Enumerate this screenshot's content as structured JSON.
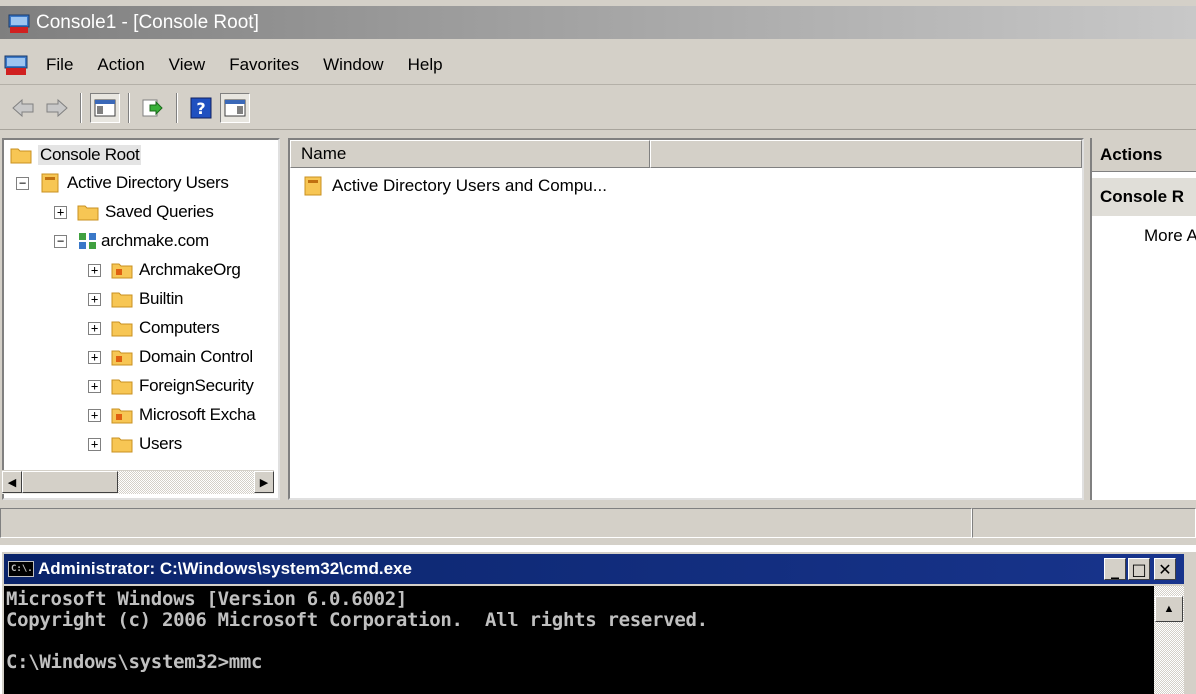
{
  "mmc": {
    "title": "Console1 - [Console Root]",
    "menu": [
      "File",
      "Action",
      "View",
      "Favorites",
      "Window",
      "Help"
    ],
    "toolbar": [
      "back-arrow-icon",
      "forward-arrow-icon",
      "show-hide-tree-icon",
      "export-list-icon",
      "help-icon",
      "show-hide-action-pane-icon"
    ],
    "tree": {
      "root": "Console Root",
      "snapin": "Active Directory Users",
      "saved_queries": "Saved Queries",
      "domain": "archmake.com",
      "children": [
        "ArchmakeOrg",
        "Builtin",
        "Computers",
        "Domain Control",
        "ForeignSecurity",
        "Microsoft Excha",
        "Users"
      ]
    },
    "list": {
      "column_name": "Name",
      "items": [
        "Active Directory Users and Compu..."
      ]
    },
    "actions": {
      "header": "Actions",
      "section": "Console R",
      "more": "More A"
    }
  },
  "cmd": {
    "title": "Administrator: C:\\Windows\\system32\\cmd.exe",
    "icon_label": "C:\\.",
    "lines": [
      "Microsoft Windows [Version 6.0.6002]",
      "Copyright (c) 2006 Microsoft Corporation.  All rights reserved.",
      "",
      "C:\\Windows\\system32>mmc"
    ],
    "buttons": [
      "_",
      "□",
      "✕"
    ]
  }
}
